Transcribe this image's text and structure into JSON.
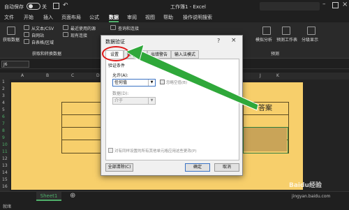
{
  "titlebar": {
    "autosave": "自动保存",
    "autosave_state": "关",
    "title": "工作簿1 - Excel"
  },
  "menu": [
    {
      "label": "文件"
    },
    {
      "label": "开始"
    },
    {
      "label": "插入"
    },
    {
      "label": "页面布局"
    },
    {
      "label": "公式"
    },
    {
      "label": "数据"
    },
    {
      "label": "审阅"
    },
    {
      "label": "视图"
    },
    {
      "label": "帮助"
    },
    {
      "label": "操作说明搜索"
    }
  ],
  "ribbon": {
    "get_data": "获取数据",
    "from_text": "从文本/CSV",
    "recent_sources": "最近使用的源",
    "from_web": "自网站",
    "existing_conn": "现有连接",
    "from_table": "自表格/区域",
    "group_get": "获取和转换数据",
    "queries": "查询和连接",
    "whatif": "模拟分析",
    "forecast_sheet": "预测工作表",
    "group_forecast": "预测",
    "outline": "分级显示"
  },
  "formula": {
    "namebox": "J6"
  },
  "columns": [
    "A",
    "B",
    "C",
    "D",
    "E",
    "F",
    "G",
    "H",
    "I",
    "J",
    "K"
  ],
  "rows": [
    "1",
    "2",
    "3",
    "4",
    "5",
    "6",
    "7",
    "8",
    "9",
    "10",
    "11",
    "12",
    "13",
    "14",
    "15",
    "16"
  ],
  "sheet": {
    "answer": "答案",
    "tab": "Sheet1",
    "add": "⊕",
    "status": "就绪"
  },
  "dialog": {
    "title": "数据验证",
    "help": "?",
    "close": "×",
    "tabs": [
      "设置",
      "输入信息",
      "出错警告",
      "输入法模式"
    ],
    "criteria": "验证条件",
    "allow_label": "允许(A):",
    "allow_value": "任何值",
    "ignore_blank": "忽略空值(B)",
    "data_label": "数据(D):",
    "data_value": "介于",
    "apply_all": "对有同样设置的所有其他单元格应用这些更改(P)",
    "clear_all": "全部清除(C)",
    "ok": "确定",
    "cancel": "取消"
  },
  "annotation": {
    "ring_color": "#e01818",
    "arrow_color": "#2fa83a"
  },
  "watermark": {
    "text": "Baidu经验",
    "sub": "jingyan.baidu.com"
  }
}
